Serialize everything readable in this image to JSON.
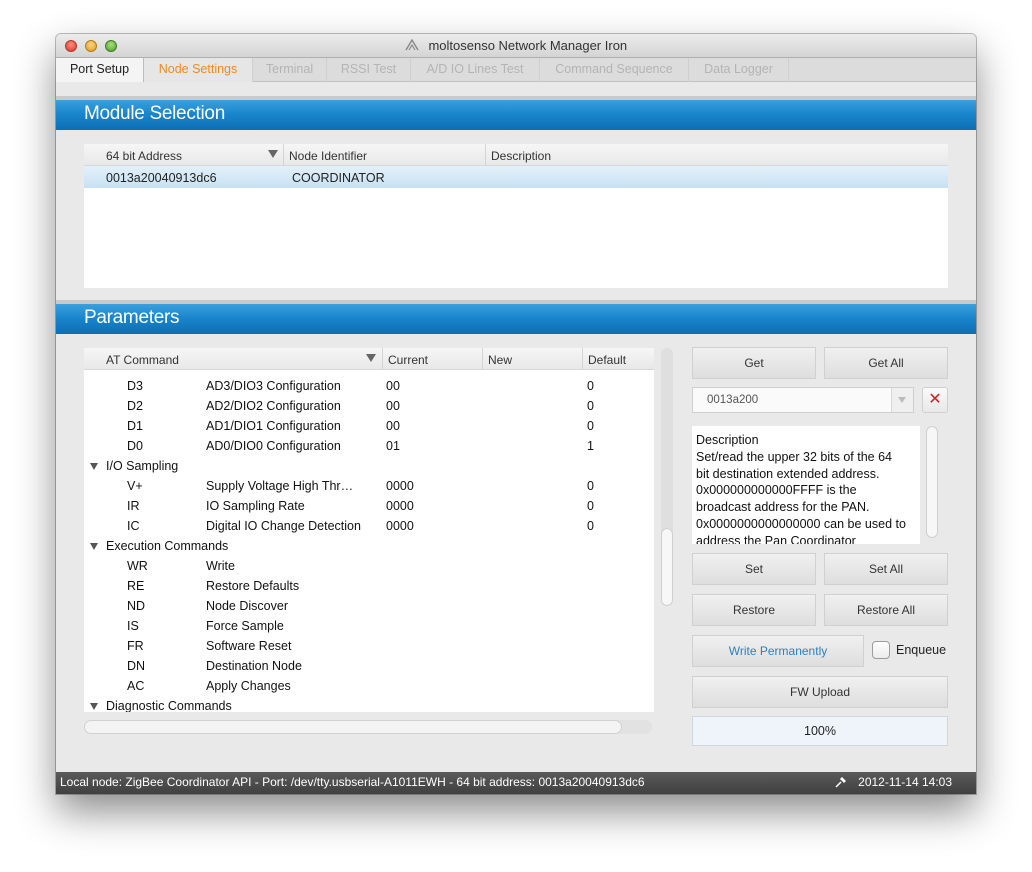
{
  "window": {
    "title": "moltosenso Network Manager Iron"
  },
  "tabs": [
    {
      "label": "Port Setup"
    },
    {
      "label": "Node Settings"
    },
    {
      "label": "Terminal"
    },
    {
      "label": "RSSI Test"
    },
    {
      "label": "A/D IO Lines Test"
    },
    {
      "label": "Command Sequence"
    },
    {
      "label": "Data Logger"
    }
  ],
  "module_selection": {
    "title": "Module Selection",
    "columns": [
      "64 bit Address",
      "Node Identifier",
      "Description"
    ],
    "rows": [
      {
        "address": "0013a20040913dc6",
        "identifier": "COORDINATOR",
        "description": ""
      }
    ]
  },
  "parameters": {
    "title": "Parameters",
    "columns": [
      "AT Command",
      "Current",
      "New",
      "Default"
    ],
    "rows": [
      {
        "cmd": "D3",
        "name": "AD3/DIO3 Configuration",
        "current": "00",
        "new": "",
        "default": "0"
      },
      {
        "cmd": "D2",
        "name": "AD2/DIO2 Configuration",
        "current": "00",
        "new": "",
        "default": "0"
      },
      {
        "cmd": "D1",
        "name": "AD1/DIO1 Configuration",
        "current": "00",
        "new": "",
        "default": "0"
      },
      {
        "cmd": "D0",
        "name": "AD0/DIO0 Configuration",
        "current": "01",
        "new": "",
        "default": "1"
      },
      {
        "group": "I/O Sampling"
      },
      {
        "cmd": "V+",
        "name": "Supply Voltage High Thr…",
        "current": "0000",
        "new": "",
        "default": "0"
      },
      {
        "cmd": "IR",
        "name": "IO Sampling Rate",
        "current": "0000",
        "new": "",
        "default": "0"
      },
      {
        "cmd": "IC",
        "name": "Digital IO Change Detection",
        "current": "0000",
        "new": "",
        "default": "0"
      },
      {
        "group": "Execution Commands"
      },
      {
        "cmd": "WR",
        "name": "Write",
        "current": "",
        "new": "",
        "default": ""
      },
      {
        "cmd": "RE",
        "name": "Restore Defaults",
        "current": "",
        "new": "",
        "default": ""
      },
      {
        "cmd": "ND",
        "name": "Node Discover",
        "current": "",
        "new": "",
        "default": ""
      },
      {
        "cmd": "IS",
        "name": "Force Sample",
        "current": "",
        "new": "",
        "default": ""
      },
      {
        "cmd": "FR",
        "name": "Software Reset",
        "current": "",
        "new": "",
        "default": ""
      },
      {
        "cmd": "DN",
        "name": "Destination Node",
        "current": "",
        "new": "",
        "default": ""
      },
      {
        "cmd": "AC",
        "name": "Apply Changes",
        "current": "",
        "new": "",
        "default": ""
      },
      {
        "group": "Diagnostic Commands"
      }
    ]
  },
  "controls": {
    "get": "Get",
    "get_all": "Get All",
    "value_combo": "0013a200",
    "clear_icon": "✕",
    "description_lines": [
      "Description",
      "Set/read the upper 32 bits of the 64",
      "bit destination extended address.",
      "0x000000000000FFFF is the",
      "broadcast address for the PAN.",
      "0x0000000000000000 can be used to",
      "address the Pan Coordinator"
    ],
    "set": "Set",
    "set_all": "Set All",
    "restore": "Restore",
    "restore_all": "Restore All",
    "write_permanently": "Write Permanently",
    "enqueue": "Enqueue",
    "fw_upload": "FW Upload",
    "progress": "100%"
  },
  "status": {
    "text": "Local node: ZigBee Coordinator API - Port: /dev/tty.usbserial-A1011EWH - 64 bit address: 0013a20040913dc6",
    "datetime": "2012-11-14 14:03"
  },
  "colors": {
    "accent_blue": "#1a86cc",
    "tab_selected": "#f08a1f",
    "clear_red": "#d02020"
  }
}
